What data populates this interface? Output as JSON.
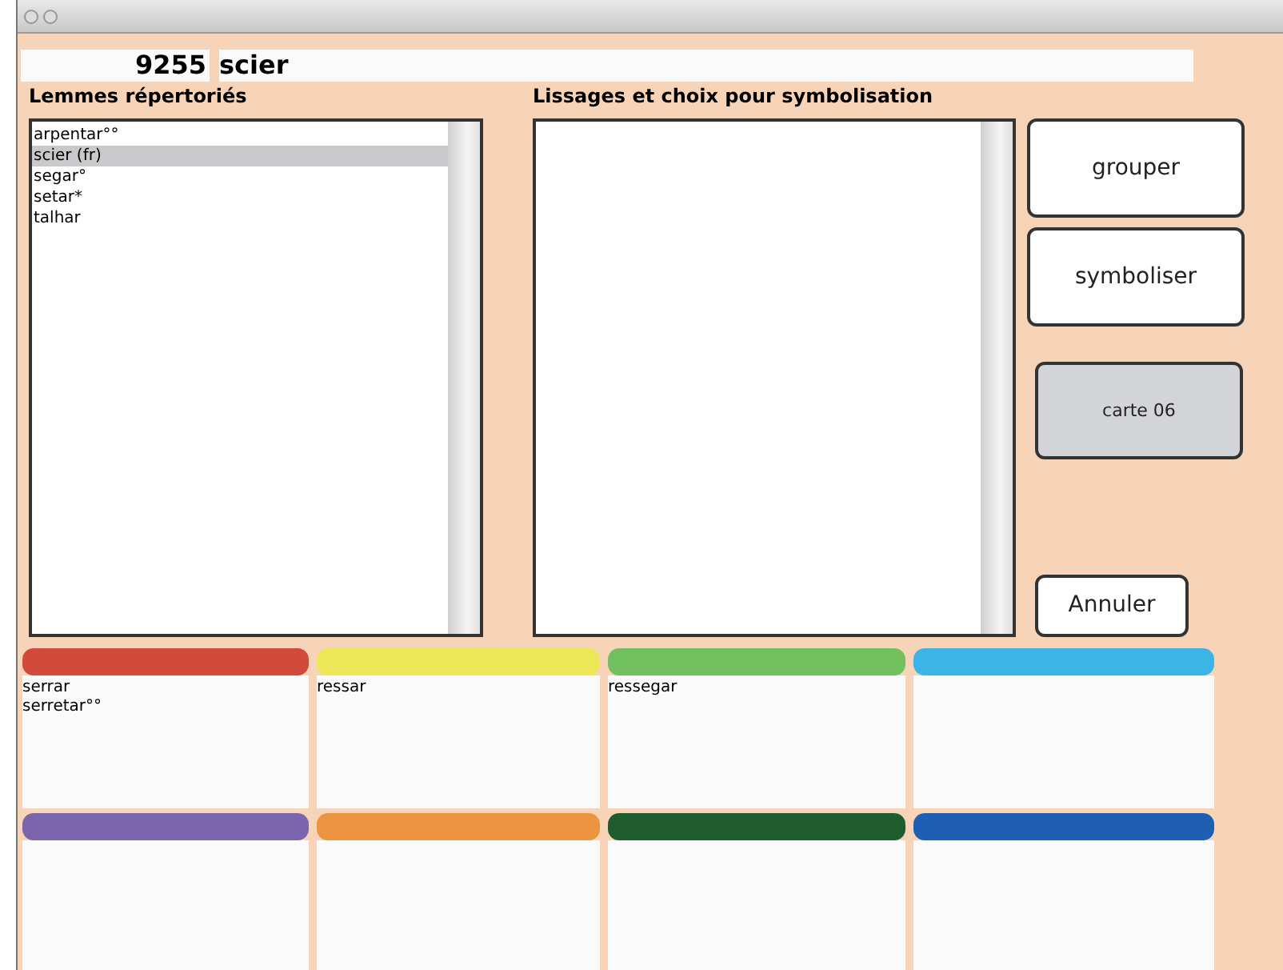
{
  "header": {
    "number": "9255",
    "word": "scier"
  },
  "lemmas": {
    "title": "Lemmes répertoriés",
    "items": [
      {
        "label": "arpentar°°",
        "selected": false
      },
      {
        "label": "scier (fr)",
        "selected": true
      },
      {
        "label": "segar°",
        "selected": false
      },
      {
        "label": "setar*",
        "selected": false
      },
      {
        "label": "talhar",
        "selected": false
      }
    ]
  },
  "smoothing": {
    "title": "Lissages et choix pour symbolisation"
  },
  "buttons": [
    {
      "label": "grouper",
      "kind": "large"
    },
    {
      "label": "symboliser",
      "kind": "large"
    },
    {
      "label": "carte 06",
      "kind": "gray"
    },
    {
      "label": "Annuler",
      "kind": "small"
    }
  ],
  "groups": [
    {
      "color": "#d24a3a",
      "items": [
        "serrar",
        "serretar°°"
      ]
    },
    {
      "color": "#ede858",
      "items": [
        "ressar"
      ]
    },
    {
      "color": "#72bf60",
      "items": [
        "ressegar"
      ]
    },
    {
      "color": "#3cb4e6"
    },
    {
      "color": "#7a65ad"
    },
    {
      "color": "#ec9440"
    },
    {
      "color": "#1f5c2e"
    },
    {
      "color": "#1e5fb4"
    }
  ]
}
